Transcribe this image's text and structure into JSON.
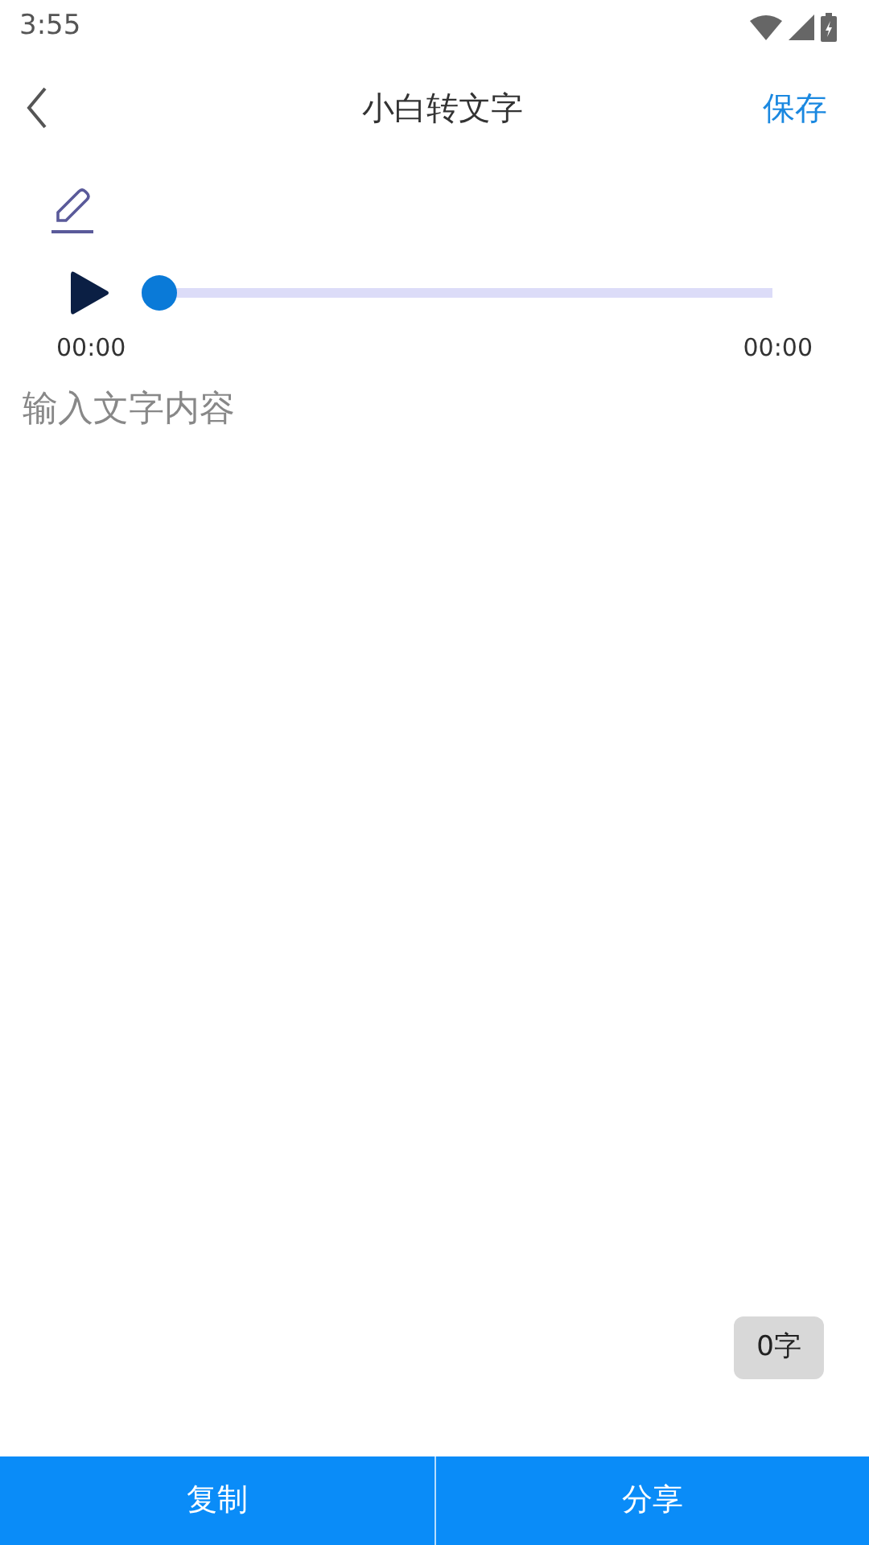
{
  "status_bar": {
    "time": "3:55"
  },
  "header": {
    "title": "小白转文字",
    "action": "保存"
  },
  "player": {
    "level": 0,
    "current_time": "00:00",
    "total_time": "00:00"
  },
  "editor": {
    "placeholder": "输入文字内容",
    "count": "0字"
  },
  "bottom_buttons": [
    "复制",
    "分享"
  ]
}
